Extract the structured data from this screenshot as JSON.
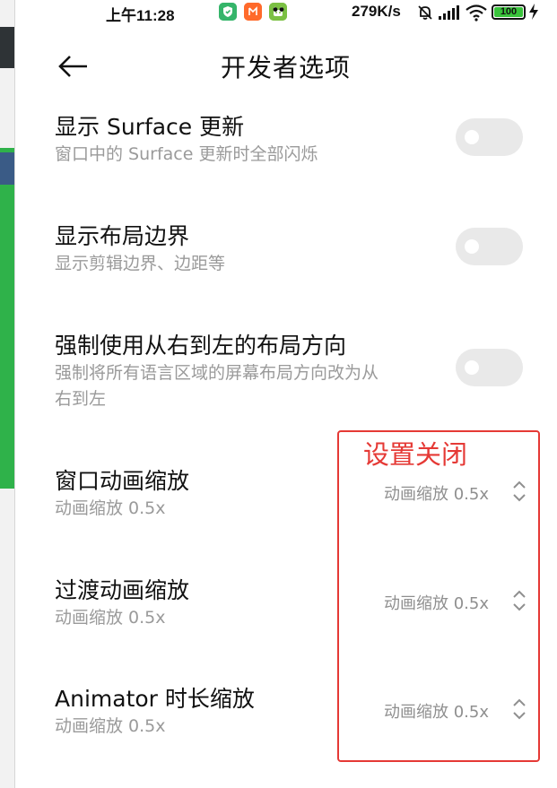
{
  "status_bar": {
    "time": "上午11:28",
    "network_speed": "279K/s",
    "battery": "100",
    "more_notifications": "••",
    "icons": [
      "shield-app-icon",
      "mi-app-icon",
      "android-app-icon",
      "mute-bell-icon",
      "signal-icon",
      "wifi-icon",
      "battery-icon",
      "charging-icon"
    ]
  },
  "header": {
    "title": "开发者选项",
    "back_icon": "arrow-left-icon"
  },
  "settings": [
    {
      "title": "显示 Surface 更新",
      "subtitle": "窗口中的 Surface 更新时全部闪烁",
      "control": "toggle",
      "on": false
    },
    {
      "title": "显示布局边界",
      "subtitle": "显示剪辑边界、边距等",
      "control": "toggle",
      "on": false
    },
    {
      "title": "强制使用从右到左的布局方向",
      "subtitle_lines": [
        "强制将所有语言区域的屏幕布局方向改为从",
        "右到左"
      ],
      "control": "toggle",
      "on": false
    },
    {
      "title": "窗口动画缩放",
      "subtitle": "动画缩放 0.5x",
      "control": "select",
      "value": "动画缩放 0.5x"
    },
    {
      "title": "过渡动画缩放",
      "subtitle": "动画缩放 0.5x",
      "control": "select",
      "value": "动画缩放 0.5x"
    },
    {
      "title": "Animator 时长缩放",
      "subtitle": "动画缩放 0.5x",
      "control": "select",
      "value": "动画缩放 0.5x"
    }
  ],
  "annotation": {
    "label": "设置关闭",
    "color": "#e53935"
  },
  "colors": {
    "toggle_off": "#e9e9e9",
    "subtitle": "#9a9a9a",
    "battery_fill": "#39c33b"
  }
}
